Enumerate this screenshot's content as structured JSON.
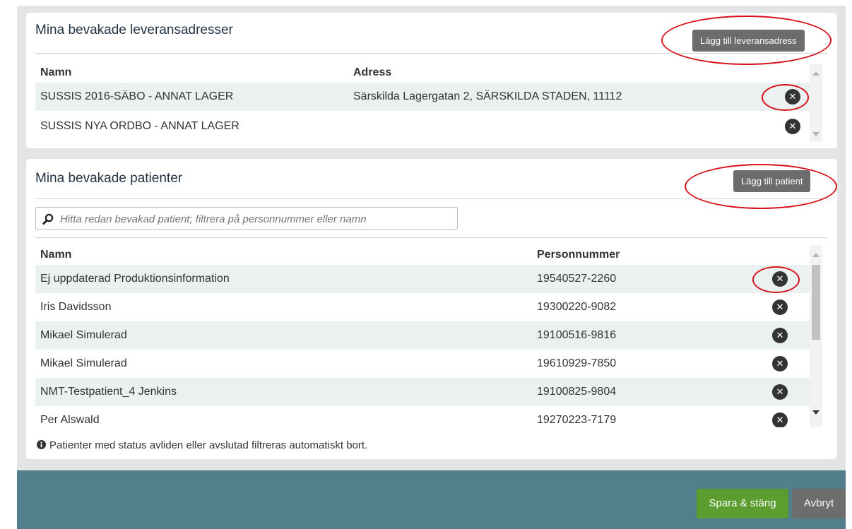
{
  "addresses": {
    "title": "Mina bevakade leveransadresser",
    "add_button": "Lägg till leveransadress",
    "headers": {
      "name": "Namn",
      "address": "Adress"
    },
    "rows": [
      {
        "name": "SUSSIS 2016-SÄBO - ANNAT LAGER",
        "address": "Särskilda Lagergatan 2, SÄRSKILDA STADEN, 11112"
      },
      {
        "name": "SUSSIS NYA ORDBO - ANNAT LAGER",
        "address": ""
      }
    ]
  },
  "patients": {
    "title": "Mina bevakade patienter",
    "add_button": "Lägg till patient",
    "search_placeholder": "Hitta redan bevakad patient; filtrera på personnummer eller namn",
    "headers": {
      "name": "Namn",
      "pnr": "Personnummer"
    },
    "rows": [
      {
        "name": "Ej uppdaterad Produktionsinformation",
        "pnr": "19540527-2260"
      },
      {
        "name": "Iris Davidsson",
        "pnr": "19300220-9082"
      },
      {
        "name": "Mikael Simulerad",
        "pnr": "19100516-9816"
      },
      {
        "name": "Mikael Simulerad",
        "pnr": "19610929-7850"
      },
      {
        "name": "NMT-Testpatient_4 Jenkins",
        "pnr": "19100825-9804"
      },
      {
        "name": "Per Alswald",
        "pnr": "19270223-7179"
      }
    ],
    "note": "Patienter med status avliden eller avslutad filtreras automatiskt bort."
  },
  "footer": {
    "save_label": "Spara & stäng",
    "cancel_label": "Avbryt"
  },
  "colors": {
    "save": "#5c9d2f",
    "cancel": "#6d6d6d",
    "highlight": "#d8101a"
  },
  "icons": {
    "remove": "close-circle-icon",
    "search": "search-icon",
    "info": "info-icon"
  }
}
